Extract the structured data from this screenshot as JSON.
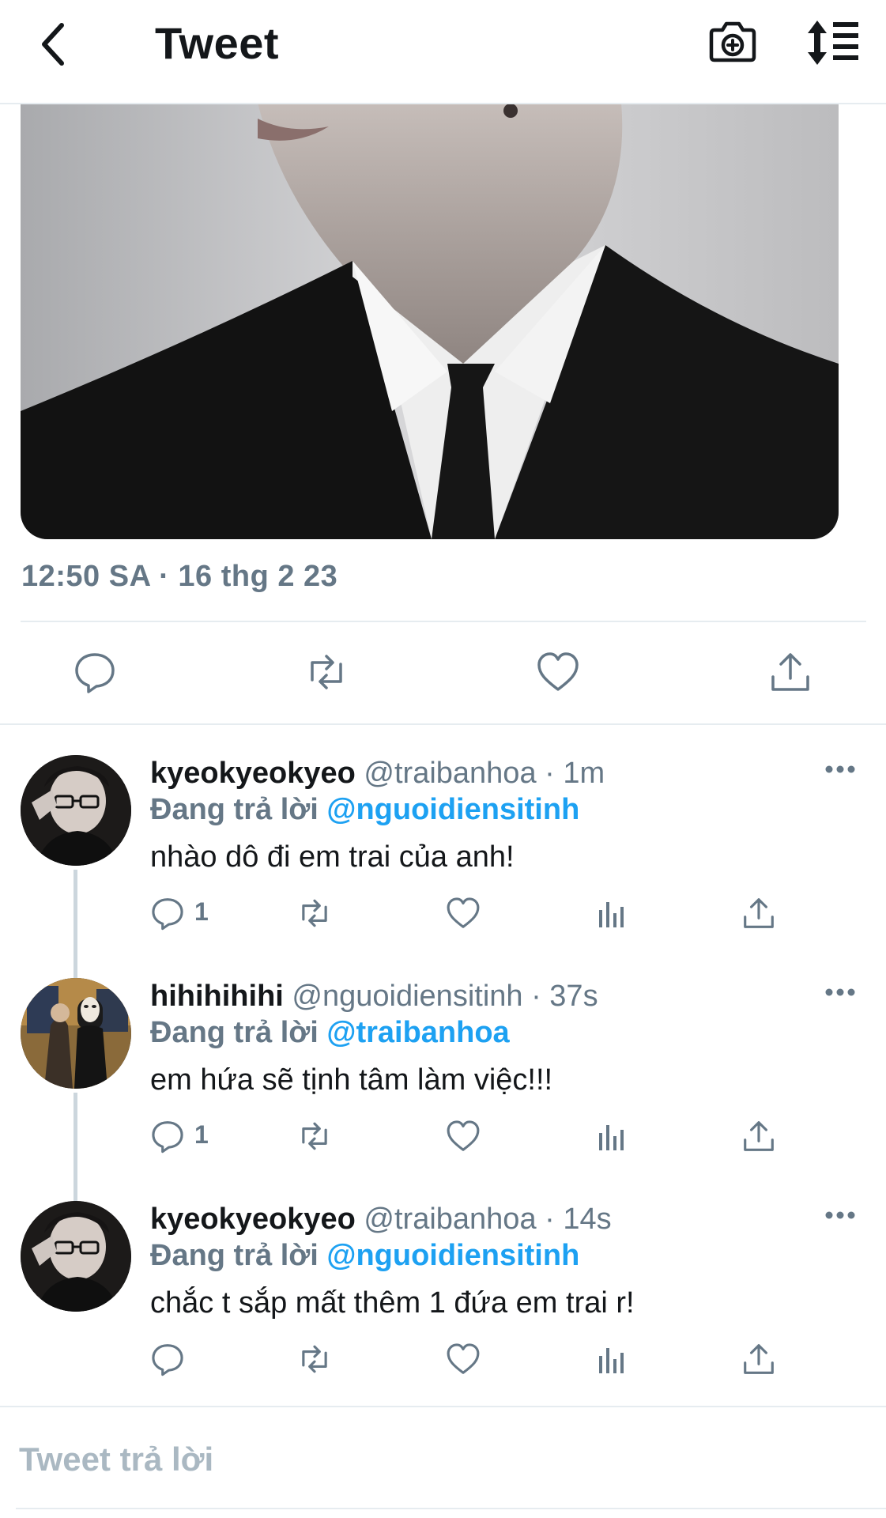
{
  "header": {
    "title": "Tweet",
    "back_icon": "back-chevron-icon",
    "camera_icon": "camera-add-icon",
    "sort_icon": "sort-icon"
  },
  "tweet": {
    "timestamp": "12:50 SA · 16 thg 2 23",
    "image": "photo of person in black suit, white shirt and black tie"
  },
  "replies": [
    {
      "name": "kyeokyeokyeo",
      "handle": "@traibanhoa · 1m",
      "replying_prefix": "Đang trả lời ",
      "replying_to": "@nguoidiensitinh",
      "text": "nhào dô đi em trai của anh!",
      "reply_count": "1"
    },
    {
      "name": "hihihihihi",
      "handle": "@nguoidiensitinh · 37s",
      "replying_prefix": "Đang trả lời ",
      "replying_to": "@traibanhoa",
      "text": "em hứa sẽ tịnh tâm làm việc!!!",
      "reply_count": "1"
    },
    {
      "name": "kyeokyeokyeo",
      "handle": "@traibanhoa · 14s",
      "replying_prefix": "Đang trả lời ",
      "replying_to": "@nguoidiensitinh",
      "text": "chắc t sắp mất thêm 1 đứa em trai r!",
      "reply_count": ""
    }
  ],
  "compose": {
    "placeholder": "Tweet trả lời"
  },
  "colors": {
    "accent": "#1da1f2",
    "muted": "#657786",
    "icon": "#657786",
    "divider": "#e6ecf0"
  }
}
